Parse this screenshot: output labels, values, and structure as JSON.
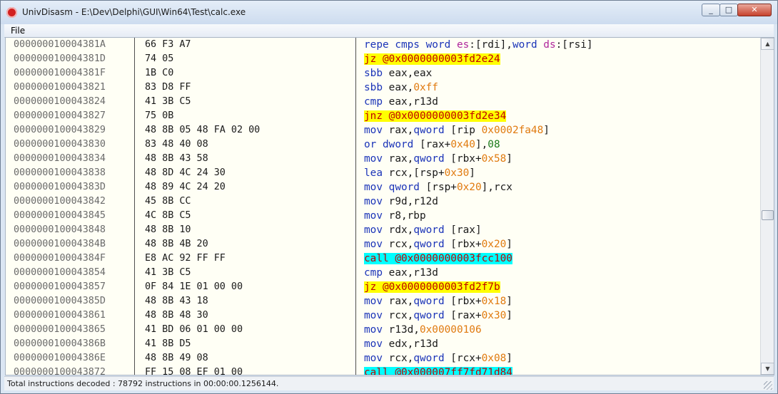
{
  "window": {
    "title": "UnivDisasm - E:\\Dev\\Delphi\\GUI\\Win64\\Test\\calc.exe",
    "min_glyph": "_",
    "max_glyph": "□",
    "close_glyph": "✕",
    "icon": "app-icon"
  },
  "menu": {
    "file": "File"
  },
  "colors": {
    "highlight_jump": "#ffff00",
    "highlight_call": "#00ffff",
    "mnemonic": "#1a33b8",
    "number": "#e07a0f",
    "segment": "#b0279c"
  },
  "rows": [
    {
      "addr": "000000010004381A",
      "bytes": "66 F3 A7",
      "asm": [
        {
          "t": "repe cmps ",
          "c": "t-m"
        },
        {
          "t": "word ",
          "c": "t-m"
        },
        {
          "t": "es",
          "c": "t-s"
        },
        {
          "t": ":[rdi],",
          "c": "t-p"
        },
        {
          "t": "word ",
          "c": "t-m"
        },
        {
          "t": "ds",
          "c": "t-s"
        },
        {
          "t": ":[rsi]",
          "c": "t-p"
        }
      ]
    },
    {
      "addr": "000000010004381D",
      "bytes": "74 05",
      "hl": "y",
      "asm": [
        {
          "t": "jz @0x0000000003fd2e24",
          "c": "t-j"
        }
      ]
    },
    {
      "addr": "000000010004381F",
      "bytes": "1B C0",
      "asm": [
        {
          "t": "sbb ",
          "c": "t-m"
        },
        {
          "t": "eax,eax",
          "c": "t-p"
        }
      ]
    },
    {
      "addr": "0000000100043821",
      "bytes": "83 D8 FF",
      "asm": [
        {
          "t": "sbb ",
          "c": "t-m"
        },
        {
          "t": "eax,",
          "c": "t-p"
        },
        {
          "t": "0xff",
          "c": "t-n"
        }
      ]
    },
    {
      "addr": "0000000100043824",
      "bytes": "41 3B C5",
      "asm": [
        {
          "t": "cmp ",
          "c": "t-m"
        },
        {
          "t": "eax,r13d",
          "c": "t-p"
        }
      ]
    },
    {
      "addr": "0000000100043827",
      "bytes": "75 0B",
      "hl": "y",
      "asm": [
        {
          "t": "jnz @0x0000000003fd2e34",
          "c": "t-j"
        }
      ]
    },
    {
      "addr": "0000000100043829",
      "bytes": "48 8B 05 48 FA 02 00",
      "asm": [
        {
          "t": "mov ",
          "c": "t-m"
        },
        {
          "t": "rax,",
          "c": "t-p"
        },
        {
          "t": "qword ",
          "c": "t-m"
        },
        {
          "t": "[rip ",
          "c": "t-p"
        },
        {
          "t": "0x0002fa48",
          "c": "t-n"
        },
        {
          "t": "]",
          "c": "t-p"
        }
      ]
    },
    {
      "addr": "0000000100043830",
      "bytes": "83 48 40 08",
      "asm": [
        {
          "t": "or ",
          "c": "t-m"
        },
        {
          "t": "dword ",
          "c": "t-m"
        },
        {
          "t": "[rax+",
          "c": "t-p"
        },
        {
          "t": "0x40",
          "c": "t-n"
        },
        {
          "t": "],",
          "c": "t-p"
        },
        {
          "t": "08",
          "c": "t-z"
        }
      ]
    },
    {
      "addr": "0000000100043834",
      "bytes": "48 8B 43 58",
      "asm": [
        {
          "t": "mov ",
          "c": "t-m"
        },
        {
          "t": "rax,",
          "c": "t-p"
        },
        {
          "t": "qword ",
          "c": "t-m"
        },
        {
          "t": "[rbx+",
          "c": "t-p"
        },
        {
          "t": "0x58",
          "c": "t-n"
        },
        {
          "t": "]",
          "c": "t-p"
        }
      ]
    },
    {
      "addr": "0000000100043838",
      "bytes": "48 8D 4C 24 30",
      "asm": [
        {
          "t": "lea ",
          "c": "t-m"
        },
        {
          "t": "rcx,[rsp+",
          "c": "t-p"
        },
        {
          "t": "0x30",
          "c": "t-n"
        },
        {
          "t": "]",
          "c": "t-p"
        }
      ]
    },
    {
      "addr": "000000010004383D",
      "bytes": "48 89 4C 24 20",
      "asm": [
        {
          "t": "mov ",
          "c": "t-m"
        },
        {
          "t": "qword ",
          "c": "t-m"
        },
        {
          "t": "[rsp+",
          "c": "t-p"
        },
        {
          "t": "0x20",
          "c": "t-n"
        },
        {
          "t": "],rcx",
          "c": "t-p"
        }
      ]
    },
    {
      "addr": "0000000100043842",
      "bytes": "45 8B CC",
      "asm": [
        {
          "t": "mov ",
          "c": "t-m"
        },
        {
          "t": "r9d,r12d",
          "c": "t-p"
        }
      ]
    },
    {
      "addr": "0000000100043845",
      "bytes": "4C 8B C5",
      "asm": [
        {
          "t": "mov ",
          "c": "t-m"
        },
        {
          "t": "r8,rbp",
          "c": "t-p"
        }
      ]
    },
    {
      "addr": "0000000100043848",
      "bytes": "48 8B 10",
      "asm": [
        {
          "t": "mov ",
          "c": "t-m"
        },
        {
          "t": "rdx,",
          "c": "t-p"
        },
        {
          "t": "qword ",
          "c": "t-m"
        },
        {
          "t": "[rax]",
          "c": "t-p"
        }
      ]
    },
    {
      "addr": "000000010004384B",
      "bytes": "48 8B 4B 20",
      "asm": [
        {
          "t": "mov ",
          "c": "t-m"
        },
        {
          "t": "rcx,",
          "c": "t-p"
        },
        {
          "t": "qword ",
          "c": "t-m"
        },
        {
          "t": "[rbx+",
          "c": "t-p"
        },
        {
          "t": "0x20",
          "c": "t-n"
        },
        {
          "t": "]",
          "c": "t-p"
        }
      ]
    },
    {
      "addr": "000000010004384F",
      "bytes": "E8 AC 92 FF FF",
      "hl": "c",
      "asm": [
        {
          "t": "call @0x0000000003fcc100",
          "c": "t-j"
        }
      ]
    },
    {
      "addr": "0000000100043854",
      "bytes": "41 3B C5",
      "asm": [
        {
          "t": "cmp ",
          "c": "t-m"
        },
        {
          "t": "eax,r13d",
          "c": "t-p"
        }
      ]
    },
    {
      "addr": "0000000100043857",
      "bytes": "0F 84 1E 01 00 00",
      "hl": "y",
      "asm": [
        {
          "t": "jz @0x0000000003fd2f7b",
          "c": "t-j"
        }
      ]
    },
    {
      "addr": "000000010004385D",
      "bytes": "48 8B 43 18",
      "asm": [
        {
          "t": "mov ",
          "c": "t-m"
        },
        {
          "t": "rax,",
          "c": "t-p"
        },
        {
          "t": "qword ",
          "c": "t-m"
        },
        {
          "t": "[rbx+",
          "c": "t-p"
        },
        {
          "t": "0x18",
          "c": "t-n"
        },
        {
          "t": "]",
          "c": "t-p"
        }
      ]
    },
    {
      "addr": "0000000100043861",
      "bytes": "48 8B 48 30",
      "asm": [
        {
          "t": "mov ",
          "c": "t-m"
        },
        {
          "t": "rcx,",
          "c": "t-p"
        },
        {
          "t": "qword ",
          "c": "t-m"
        },
        {
          "t": "[rax+",
          "c": "t-p"
        },
        {
          "t": "0x30",
          "c": "t-n"
        },
        {
          "t": "]",
          "c": "t-p"
        }
      ]
    },
    {
      "addr": "0000000100043865",
      "bytes": "41 BD 06 01 00 00",
      "asm": [
        {
          "t": "mov ",
          "c": "t-m"
        },
        {
          "t": "r13d,",
          "c": "t-p"
        },
        {
          "t": "0x00000106",
          "c": "t-n"
        }
      ]
    },
    {
      "addr": "000000010004386B",
      "bytes": "41 8B D5",
      "asm": [
        {
          "t": "mov ",
          "c": "t-m"
        },
        {
          "t": "edx,r13d",
          "c": "t-p"
        }
      ]
    },
    {
      "addr": "000000010004386E",
      "bytes": "48 8B 49 08",
      "asm": [
        {
          "t": "mov ",
          "c": "t-m"
        },
        {
          "t": "rcx,",
          "c": "t-p"
        },
        {
          "t": "qword ",
          "c": "t-m"
        },
        {
          "t": "[rcx+",
          "c": "t-p"
        },
        {
          "t": "0x08",
          "c": "t-n"
        },
        {
          "t": "]",
          "c": "t-p"
        }
      ]
    },
    {
      "addr": "0000000100043872",
      "bytes": "FF 15 08 EF 01 00",
      "hl": "c",
      "asm": [
        {
          "t": "call @0x000007ff7fd71d84",
          "c": "t-j"
        }
      ]
    }
  ],
  "status": {
    "text": "Total instructions decoded : 78792 instructions in 00:00:00.1256144."
  }
}
